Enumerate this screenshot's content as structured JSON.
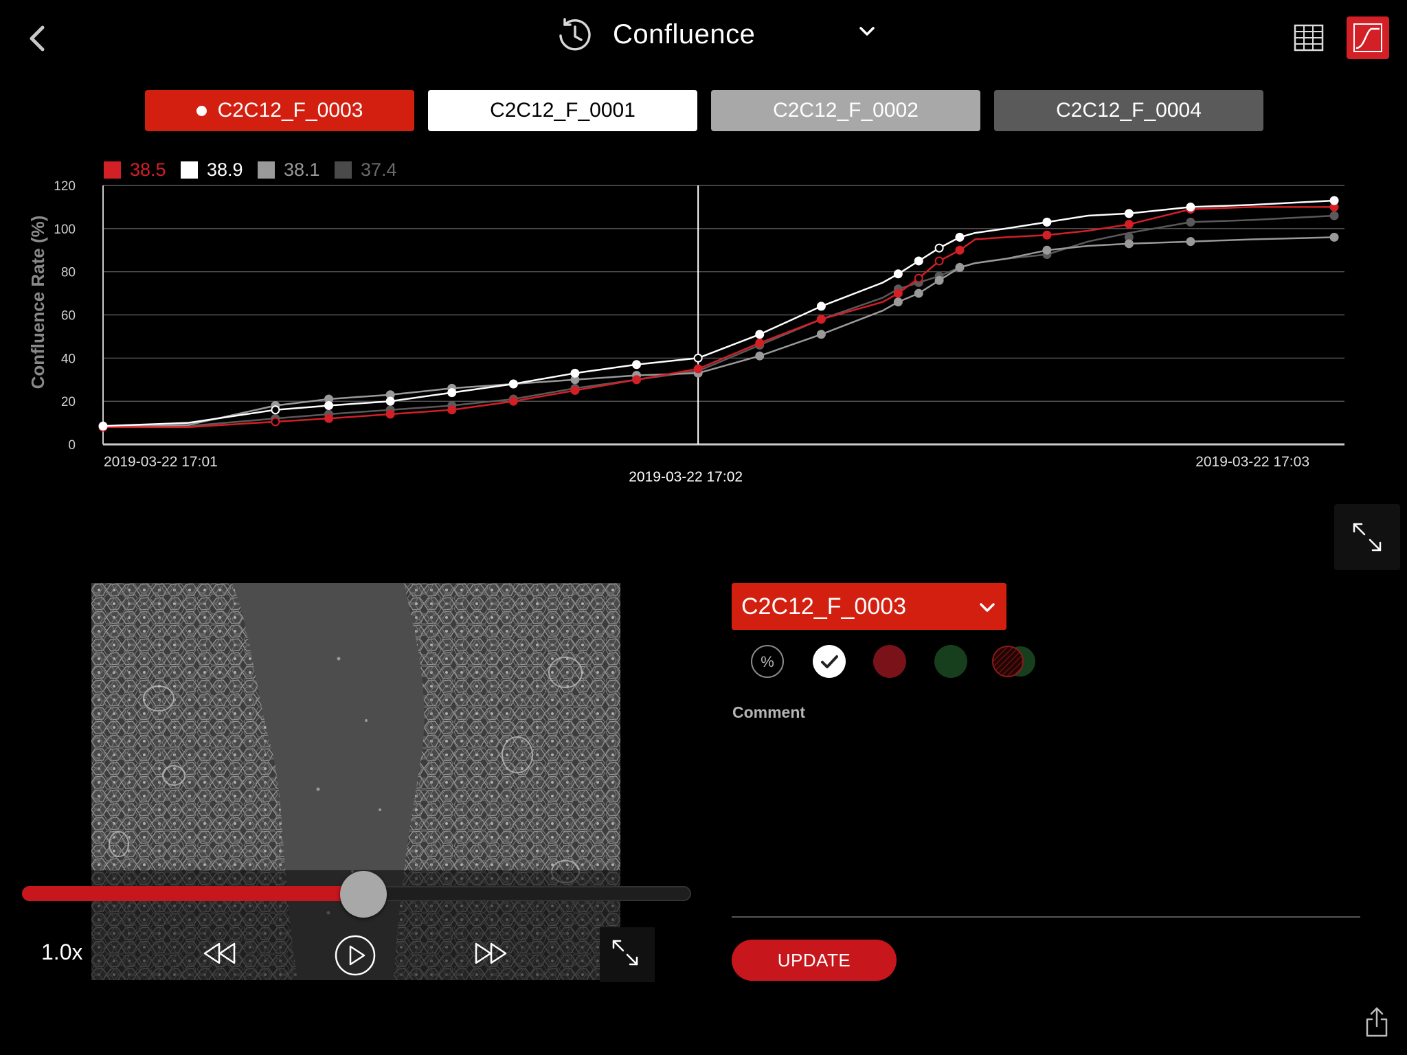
{
  "header": {
    "title": "Confluence",
    "icons": {
      "back": "back-chevron-icon",
      "title": "clock-history-icon",
      "dropdown": "chevron-down-icon",
      "table_view": "table-grid-icon",
      "chart_view": "growth-curve-icon"
    }
  },
  "tabs": [
    {
      "label": "C2C12_F_0003",
      "selected": true,
      "bg": "#d31f10",
      "fg": "#ffffff"
    },
    {
      "label": "C2C12_F_0001",
      "selected": false,
      "bg": "#ffffff",
      "fg": "#000000"
    },
    {
      "label": "C2C12_F_0002",
      "selected": false,
      "bg": "#a8a8a8",
      "fg": "#ffffff"
    },
    {
      "label": "C2C12_F_0004",
      "selected": false,
      "bg": "#5a5a5a",
      "fg": "#ffffff"
    }
  ],
  "chart_data": {
    "type": "line",
    "title": "",
    "ylabel": "Confluence Rate (%)",
    "xlabel": "",
    "ylim": [
      0,
      120
    ],
    "yticks": [
      "0",
      "20",
      "40",
      "60",
      "80",
      "100",
      "120"
    ],
    "xticks": [
      {
        "label": "2019-03-22 17:01",
        "t": 0
      },
      {
        "label": "2019-03-22 17:03",
        "t": 120
      }
    ],
    "cursor": {
      "label": "2019-03-22 17:02",
      "t": 58
    },
    "legend": [
      {
        "value": "38.5",
        "color": "#d31f26"
      },
      {
        "value": "38.9",
        "color": "#ffffff"
      },
      {
        "value": "38.1",
        "color": "#9a9a9a"
      },
      {
        "value": "37.4",
        "color": "#4a4a4a"
      }
    ],
    "grid": true,
    "series": [
      {
        "color": "#d31f26",
        "points": [
          [
            0,
            8
          ],
          [
            8.3,
            8
          ],
          [
            16.8,
            10.5
          ],
          [
            22,
            12
          ],
          [
            28,
            14
          ],
          [
            34,
            16
          ],
          [
            40,
            20
          ],
          [
            46,
            25
          ],
          [
            52,
            30
          ],
          [
            58,
            35
          ],
          [
            64,
            47
          ],
          [
            70,
            58
          ],
          [
            76,
            66
          ],
          [
            77.5,
            70
          ],
          [
            79.5,
            77
          ],
          [
            81.5,
            85
          ],
          [
            83.5,
            90
          ],
          [
            85,
            95
          ],
          [
            88,
            96
          ],
          [
            92,
            97
          ],
          [
            96,
            99
          ],
          [
            100,
            102
          ],
          [
            106,
            109
          ],
          [
            112,
            110
          ],
          [
            120,
            110
          ]
        ],
        "markers": [
          [
            0,
            8
          ],
          [
            16.8,
            10.5
          ],
          [
            22,
            12
          ],
          [
            28,
            14
          ],
          [
            34,
            16
          ],
          [
            40,
            20
          ],
          [
            46,
            25
          ],
          [
            52,
            30
          ],
          [
            58,
            35
          ],
          [
            64,
            47
          ],
          [
            70,
            58
          ],
          [
            77.5,
            70
          ],
          [
            79.5,
            77
          ],
          [
            81.5,
            85
          ],
          [
            83.5,
            90
          ],
          [
            92,
            97
          ],
          [
            100,
            102
          ],
          [
            106,
            109
          ],
          [
            120,
            110
          ]
        ],
        "hollow": [
          0,
          16.8,
          79.5,
          81.5
        ]
      },
      {
        "color": "#ffffff",
        "points": [
          [
            0,
            8.5
          ],
          [
            8.3,
            10
          ],
          [
            16.8,
            16
          ],
          [
            22,
            18
          ],
          [
            28,
            20
          ],
          [
            34,
            24
          ],
          [
            40,
            28
          ],
          [
            46,
            33
          ],
          [
            52,
            37
          ],
          [
            58,
            40
          ],
          [
            64,
            51
          ],
          [
            70,
            64
          ],
          [
            76,
            75
          ],
          [
            77.5,
            79
          ],
          [
            79.5,
            85
          ],
          [
            81.5,
            91
          ],
          [
            83.5,
            96
          ],
          [
            85,
            98
          ],
          [
            88,
            100
          ],
          [
            92,
            103
          ],
          [
            96,
            106
          ],
          [
            100,
            107
          ],
          [
            106,
            110
          ],
          [
            112,
            111
          ],
          [
            120,
            113
          ]
        ],
        "markers": [
          [
            0,
            8.5
          ],
          [
            16.8,
            16
          ],
          [
            22,
            18
          ],
          [
            28,
            20
          ],
          [
            34,
            24
          ],
          [
            40,
            28
          ],
          [
            46,
            33
          ],
          [
            52,
            37
          ],
          [
            58,
            40
          ],
          [
            64,
            51
          ],
          [
            70,
            64
          ],
          [
            77.5,
            79
          ],
          [
            79.5,
            85
          ],
          [
            81.5,
            91
          ],
          [
            83.5,
            96
          ],
          [
            92,
            103
          ],
          [
            100,
            107
          ],
          [
            106,
            110
          ],
          [
            120,
            113
          ]
        ],
        "hollow": [
          16.8,
          58,
          81.5
        ]
      },
      {
        "color": "#9a9a9a",
        "points": [
          [
            0,
            8
          ],
          [
            8.3,
            9
          ],
          [
            16.8,
            18
          ],
          [
            22,
            21
          ],
          [
            28,
            23
          ],
          [
            34,
            26
          ],
          [
            40,
            28
          ],
          [
            46,
            30
          ],
          [
            52,
            32
          ],
          [
            58,
            33
          ],
          [
            64,
            41
          ],
          [
            70,
            51
          ],
          [
            76,
            62
          ],
          [
            77.5,
            66
          ],
          [
            79.5,
            70
          ],
          [
            81.5,
            76
          ],
          [
            83.5,
            82
          ],
          [
            85,
            84
          ],
          [
            88,
            86
          ],
          [
            92,
            90
          ],
          [
            96,
            92
          ],
          [
            100,
            93
          ],
          [
            106,
            94
          ],
          [
            112,
            95
          ],
          [
            120,
            96
          ]
        ],
        "markers": [
          [
            0,
            8
          ],
          [
            16.8,
            18
          ],
          [
            22,
            21
          ],
          [
            28,
            23
          ],
          [
            34,
            26
          ],
          [
            40,
            28
          ],
          [
            46,
            30
          ],
          [
            52,
            32
          ],
          [
            58,
            33
          ],
          [
            64,
            41
          ],
          [
            70,
            51
          ],
          [
            77.5,
            66
          ],
          [
            79.5,
            70
          ],
          [
            81.5,
            76
          ],
          [
            83.5,
            82
          ],
          [
            92,
            90
          ],
          [
            100,
            93
          ],
          [
            106,
            94
          ],
          [
            120,
            96
          ]
        ],
        "hollow": []
      },
      {
        "color": "#5a5a5a",
        "points": [
          [
            0,
            8
          ],
          [
            8.3,
            8.5
          ],
          [
            16.8,
            12
          ],
          [
            22,
            14
          ],
          [
            28,
            16
          ],
          [
            34,
            18
          ],
          [
            40,
            21
          ],
          [
            46,
            26
          ],
          [
            52,
            30
          ],
          [
            58,
            34
          ],
          [
            64,
            46
          ],
          [
            70,
            58
          ],
          [
            76,
            68
          ],
          [
            77.5,
            72
          ],
          [
            79.5,
            75
          ],
          [
            81.5,
            78
          ],
          [
            83.5,
            82
          ],
          [
            85,
            84
          ],
          [
            88,
            86
          ],
          [
            92,
            88
          ],
          [
            96,
            94
          ],
          [
            100,
            98
          ],
          [
            106,
            103
          ],
          [
            112,
            104
          ],
          [
            120,
            106
          ]
        ],
        "markers": [
          [
            0,
            8
          ],
          [
            16.8,
            12
          ],
          [
            22,
            14
          ],
          [
            28,
            16
          ],
          [
            34,
            18
          ],
          [
            40,
            21
          ],
          [
            46,
            26
          ],
          [
            52,
            30
          ],
          [
            58,
            34
          ],
          [
            64,
            46
          ],
          [
            70,
            58
          ],
          [
            77.5,
            72
          ],
          [
            79.5,
            75
          ],
          [
            81.5,
            78
          ],
          [
            83.5,
            82
          ],
          [
            92,
            88
          ],
          [
            100,
            96
          ],
          [
            106,
            103
          ],
          [
            120,
            106
          ]
        ],
        "hollow": []
      }
    ]
  },
  "viewer": {
    "speed": "1.0x",
    "progress": 0.51,
    "icons": {
      "rewind": "rewind-icon",
      "play": "play-circle-icon",
      "forward": "fast-forward-icon",
      "expand": "expand-arrows-icon"
    }
  },
  "panel": {
    "selected_well": "C2C12_F_0003",
    "color_options": [
      {
        "name": "percent-option",
        "icon": "percent-icon",
        "fill": "#000000",
        "border": "#8a8a8a",
        "selected": false
      },
      {
        "name": "white-option",
        "icon": "checkmark-icon",
        "fill": "#ffffff",
        "border": "#ffffff",
        "selected": true
      },
      {
        "name": "dark-red-option",
        "icon": "",
        "fill": "#7a121a",
        "border": "#7a121a",
        "selected": false
      },
      {
        "name": "dark-green-option",
        "icon": "",
        "fill": "#173f1e",
        "border": "#173f1e",
        "selected": false
      },
      {
        "name": "mixed-option",
        "icon": "hatched-circle-icon",
        "fill": "#2a0505",
        "border": "#8a1a1a",
        "selected": false
      }
    ],
    "comment_label": "Comment",
    "comment_value": "",
    "update_label": "UPDATE",
    "share_icon": "share-icon"
  },
  "colors": {
    "accent": "#d31f26",
    "background": "#000000",
    "grid": "#6a6a6a"
  }
}
